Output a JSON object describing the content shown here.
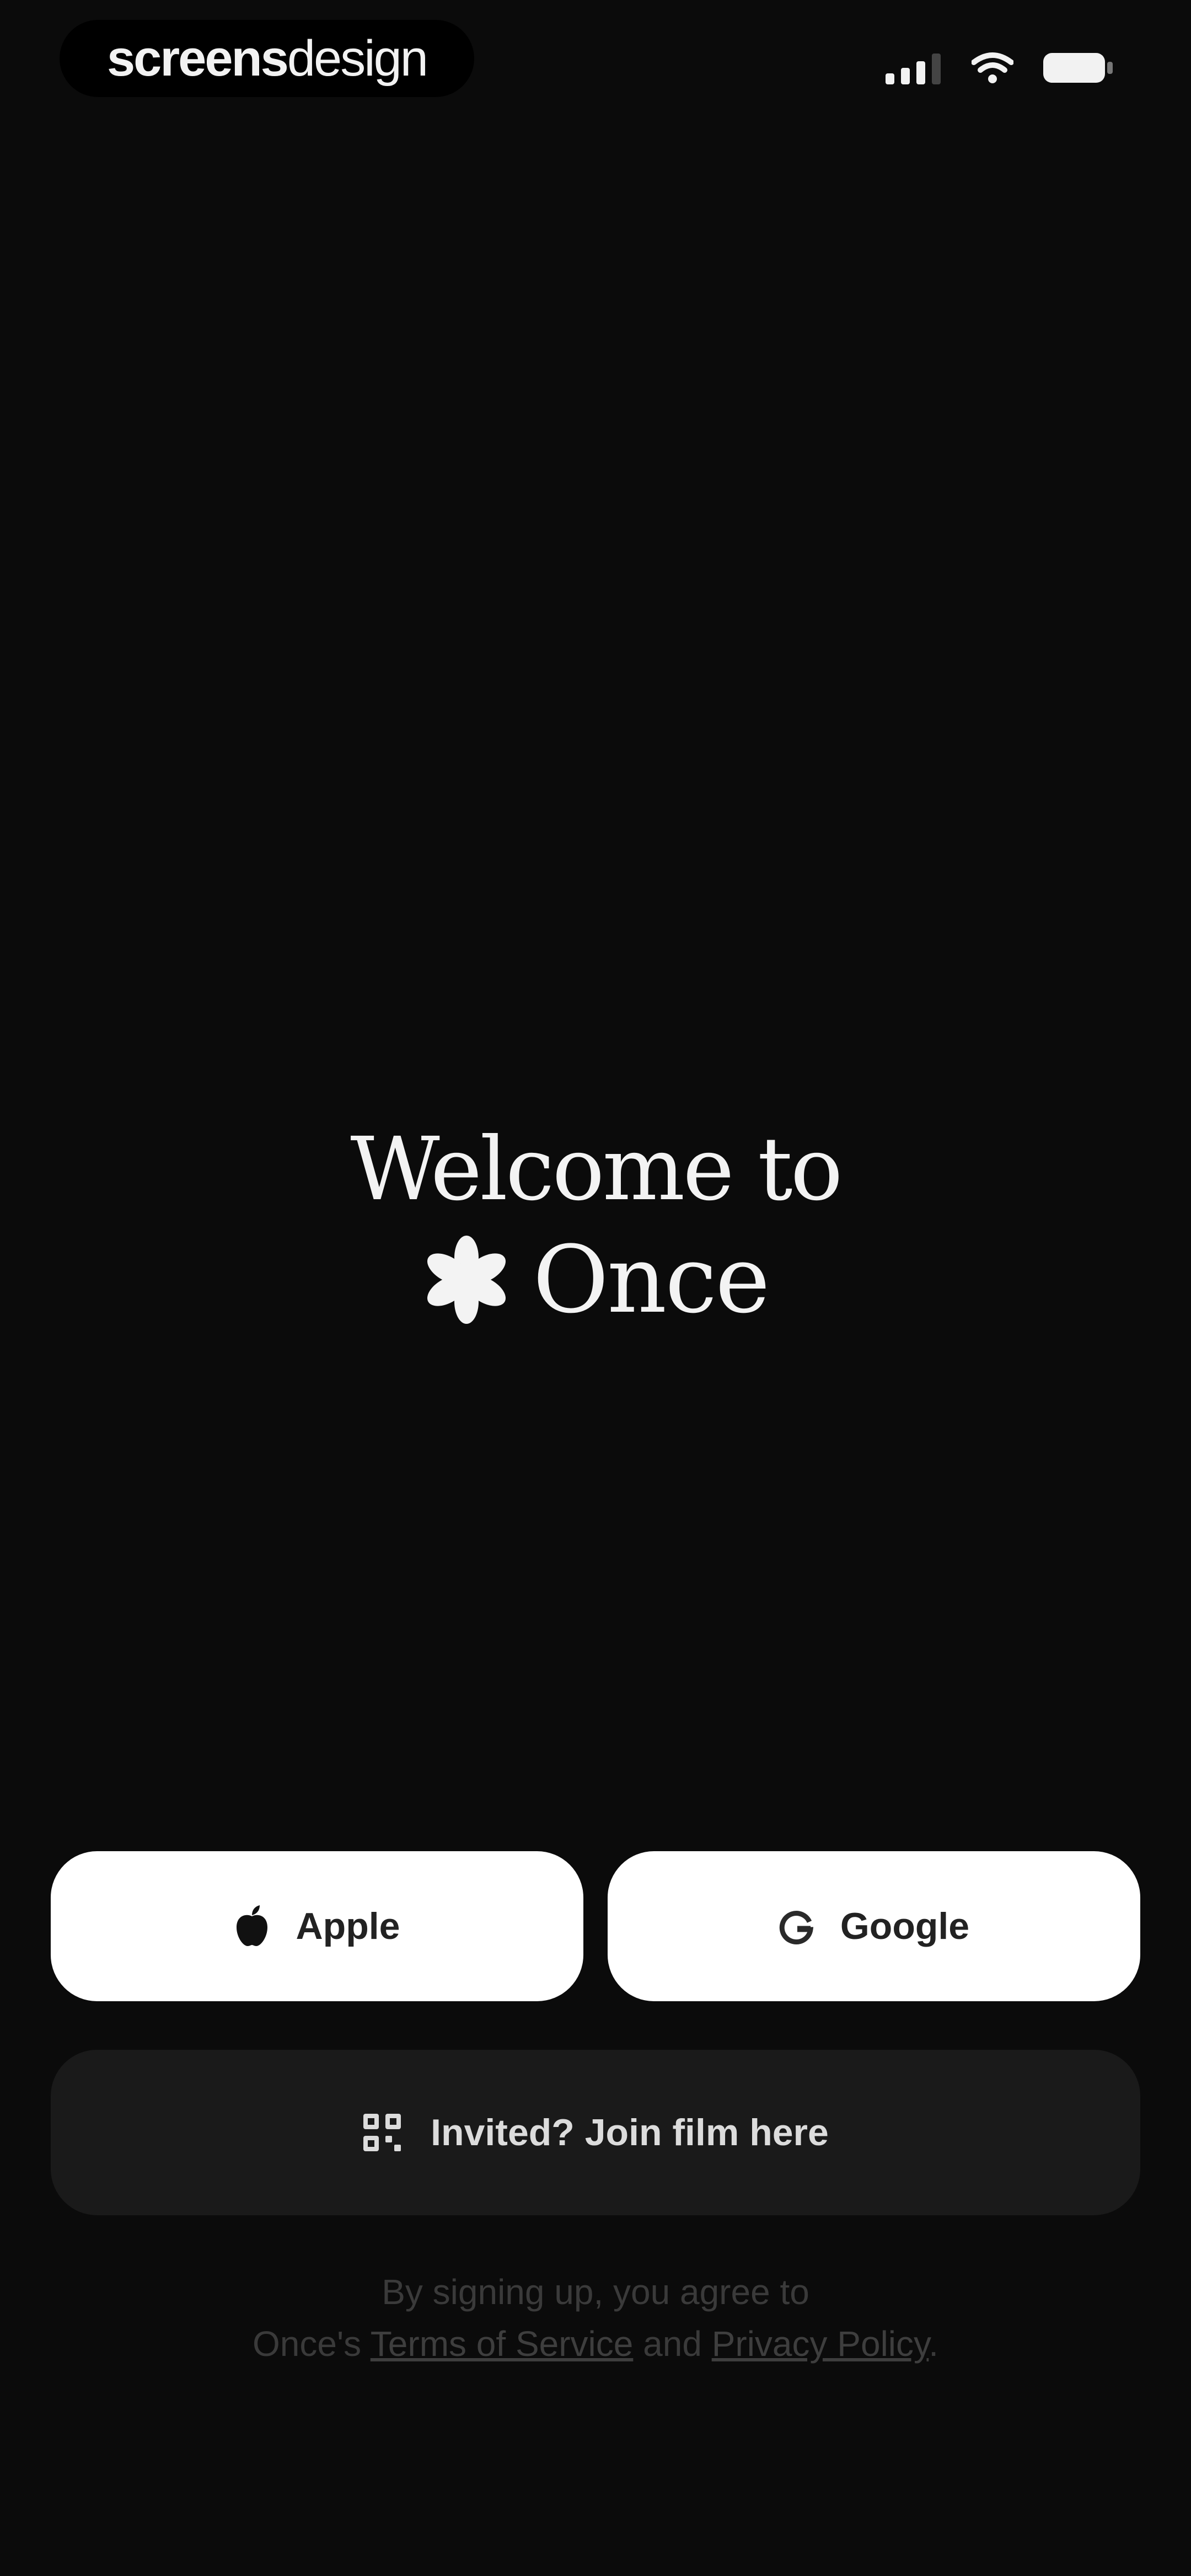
{
  "status_bar": {
    "watermark_part_1": "screens",
    "watermark_part_2": "design",
    "icons": [
      "signal-icon",
      "wifi-icon",
      "battery-icon"
    ]
  },
  "welcome": {
    "line_1": "Welcome to",
    "brand_icon": "asterisk-flower-icon",
    "brand_name": "Once"
  },
  "auth": {
    "apple": {
      "label": "Apple",
      "icon": "apple-icon"
    },
    "google": {
      "label": "Google",
      "icon": "google-icon"
    },
    "invite": {
      "label": "Invited? Join film here",
      "icon": "qr-code-icon"
    }
  },
  "legal": {
    "line_1": "By signing up, you agree to",
    "prefix": "Once's",
    "terms": "Terms of Service",
    "conjunction": "and",
    "privacy": "Privacy Policy",
    "suffix": "."
  },
  "colors": {
    "background": "#0b0b0b",
    "primary_button": "#ffffff",
    "secondary_button": "#1a1a1a",
    "legal_text": "#3a3a3a"
  }
}
